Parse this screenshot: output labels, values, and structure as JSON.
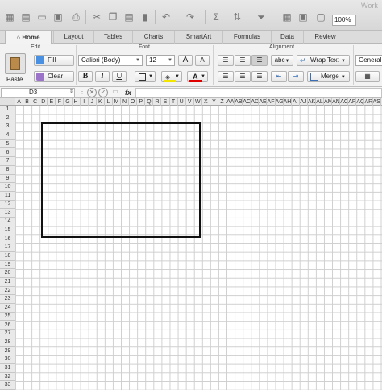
{
  "window": {
    "title": "Work"
  },
  "toolbar": {
    "zoom": "100%"
  },
  "tabs": [
    {
      "label": "Home",
      "active": true
    },
    {
      "label": "Layout"
    },
    {
      "label": "Tables"
    },
    {
      "label": "Charts"
    },
    {
      "label": "SmartArt"
    },
    {
      "label": "Formulas"
    },
    {
      "label": "Data"
    },
    {
      "label": "Review"
    }
  ],
  "ribbon": {
    "edit": {
      "title": "Edit",
      "paste": "Paste",
      "fill": "Fill",
      "clear": "Clear"
    },
    "font": {
      "title": "Font",
      "name": "Calibri (Body)",
      "size": "12",
      "bold": "B",
      "italic": "I",
      "underline": "U",
      "grow": "A",
      "shrink": "A",
      "fill_color": "#f2e600",
      "font_color": "#e00000"
    },
    "alignment": {
      "title": "Alignment",
      "orientation": "abc",
      "wrap": "Wrap Text",
      "merge": "Merge"
    },
    "number": {
      "format": "General"
    }
  },
  "formula_bar": {
    "name_box": "D3",
    "fx": "fx",
    "value": ""
  },
  "columns": [
    "A",
    "B",
    "C",
    "D",
    "E",
    "F",
    "G",
    "H",
    "I",
    "J",
    "K",
    "L",
    "M",
    "N",
    "O",
    "P",
    "Q",
    "R",
    "S",
    "T",
    "U",
    "V",
    "W",
    "X",
    "Y",
    "Z",
    "AA",
    "AB",
    "AC",
    "AD",
    "AE",
    "AF",
    "AG",
    "AH",
    "AI",
    "AJ",
    "AK",
    "AL",
    "AM",
    "AN",
    "AO",
    "AP",
    "AQ",
    "AR",
    "AS"
  ],
  "rows": [
    "1",
    "2",
    "3",
    "4",
    "5",
    "6",
    "7",
    "8",
    "9",
    "10",
    "11",
    "12",
    "13",
    "14",
    "15",
    "16",
    "17",
    "18",
    "19",
    "20",
    "21",
    "22",
    "23",
    "24",
    "25",
    "26",
    "27",
    "28",
    "29",
    "30",
    "31",
    "32",
    "33"
  ],
  "selection": {
    "range": "D3:V15"
  }
}
